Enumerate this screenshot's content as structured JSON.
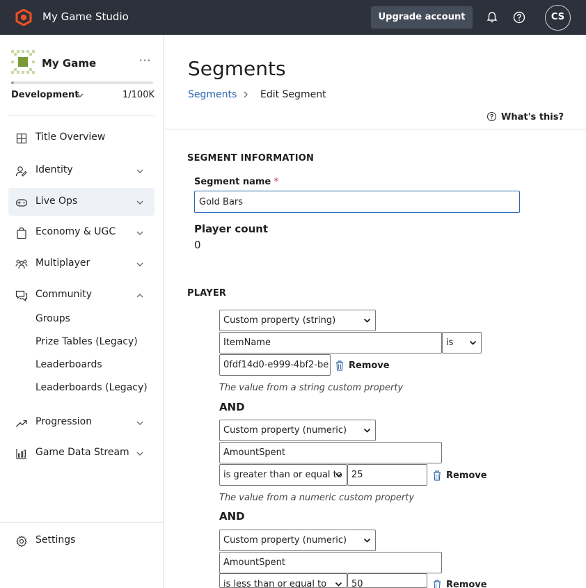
{
  "topbar": {
    "studio_name": "My Game Studio",
    "upgrade_label": "Upgrade account",
    "avatar_initials": "CS",
    "logo_icon": "gamestudio-logo-icon",
    "bell_icon": "bell-icon",
    "help_icon": "help-icon",
    "accent": "#f25022"
  },
  "sidebar": {
    "game_name": "My Game",
    "more_label": "···",
    "environment": "Development",
    "usage": "1/100K",
    "usage_fraction": 0.01,
    "nav": [
      {
        "label": "Title Overview",
        "icon": "grid-icon"
      },
      {
        "label": "Identity",
        "icon": "identity-icon"
      },
      {
        "label": "Live Ops",
        "icon": "gamepad-icon"
      },
      {
        "label": "Economy & UGC",
        "icon": "shopping-bag-icon"
      },
      {
        "label": "Multiplayer",
        "icon": "people-icon"
      },
      {
        "label": "Community",
        "icon": "chat-icon"
      },
      {
        "label": "Progression",
        "icon": "trend-icon"
      },
      {
        "label": "Game Data Stream",
        "icon": "bar-chart-icon"
      }
    ],
    "community_sub": [
      "Groups",
      "Prize Tables (Legacy)",
      "Leaderboards",
      "Leaderboards (Legacy)"
    ],
    "settings_label": "Settings"
  },
  "main": {
    "title": "Segments",
    "breadcrumb": [
      "Segments",
      "Edit Segment"
    ],
    "whats_this": "What's this?",
    "segment_info_heading": "SEGMENT INFORMATION",
    "segment_name_label": "Segment name",
    "required_mark": "*",
    "segment_name_value": "Gold Bars",
    "player_count_label": "Player count",
    "player_count_value": "0",
    "player_heading": "PLAYER",
    "remove_label": "Remove",
    "and_label": "AND",
    "filters": [
      {
        "type": "Custom property (string)",
        "property": "ItemName",
        "operator": "is",
        "value": "0fdf14d0-e999-4bf2-be",
        "hint": "The value from a string custom property"
      },
      {
        "type": "Custom property (numeric)",
        "property": "AmountSpent",
        "operator": "is greater than or equal to",
        "value": "25",
        "hint": "The value from a numeric custom property"
      },
      {
        "type": "Custom property (numeric)",
        "property": "AmountSpent",
        "operator": "is less than or equal to",
        "value": "50"
      }
    ]
  }
}
